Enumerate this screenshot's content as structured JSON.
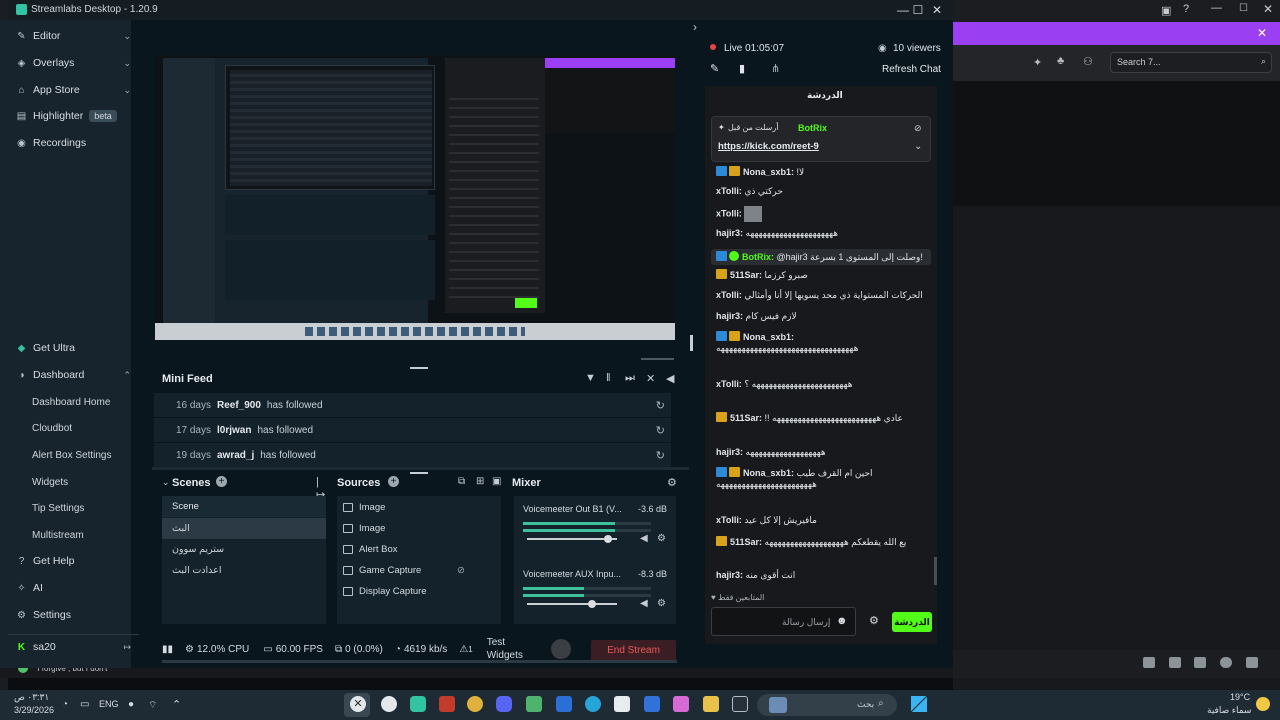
{
  "window": {
    "title": "Streamlabs Desktop - 1.20.9"
  },
  "bg_right": {
    "search_placeholder": "Search 7..."
  },
  "sidebar": {
    "items": [
      {
        "label": "Editor",
        "icon": "editor-icon"
      },
      {
        "label": "Overlays",
        "icon": "overlays-icon"
      },
      {
        "label": "App Store",
        "icon": "app-store-icon"
      },
      {
        "label": "Highlighter",
        "icon": "highlighter-icon",
        "badge": "beta"
      },
      {
        "label": "Recordings",
        "icon": "recordings-icon"
      }
    ],
    "bottom_items": [
      {
        "label": "Get Ultra",
        "icon": "ultra-icon"
      },
      {
        "label": "Dashboard",
        "icon": "dashboard-icon"
      }
    ],
    "dashboard_sub": [
      "Dashboard Home",
      "Cloudbot",
      "Alert Box Settings",
      "Widgets",
      "Tip Settings",
      "Multistream"
    ],
    "footer_items": [
      {
        "label": "Get Help",
        "icon": "help-icon"
      },
      {
        "label": "AI",
        "icon": "ai-icon"
      },
      {
        "label": "Settings",
        "icon": "settings-icon"
      }
    ],
    "user": "sa20"
  },
  "mini_feed": {
    "title": "Mini Feed",
    "rows": [
      {
        "days": "16 days",
        "user": "Reef_900",
        "action": "has followed"
      },
      {
        "days": "17 days",
        "user": "l0rjwan",
        "action": "has followed"
      },
      {
        "days": "19 days",
        "user": "awrad_j",
        "action": "has followed"
      }
    ]
  },
  "scenes": {
    "title": "Scenes",
    "header": "Scene",
    "items": [
      "البث",
      "ستريم سوون",
      "اعدادت البث"
    ]
  },
  "sources": {
    "title": "Sources",
    "items": [
      "Image",
      "Image",
      "Alert Box",
      "Game Capture",
      "Display Capture"
    ]
  },
  "mixer": {
    "title": "Mixer",
    "channels": [
      {
        "name": "Voicemeeter Out B1 (V...",
        "db": "-3.6 dB",
        "level": 0.72,
        "volume": 0.9
      },
      {
        "name": "Voicemeeter AUX Inpu...",
        "db": "-8.3 dB",
        "level": 0.48,
        "volume": 0.72
      }
    ]
  },
  "status": {
    "cpu": "12.0% CPU",
    "fps": "60.00 FPS",
    "dropped": "0 (0.0%)",
    "bitrate": "4619 kb/s",
    "alerts": "1",
    "test_widgets": "Test Widgets",
    "end_stream": "End Stream"
  },
  "chat": {
    "live": "Live 01:05:07",
    "viewers": "10 viewers",
    "refresh": "Refresh Chat",
    "title": "الدردشة",
    "pinned_by": "أرسلت من قبل",
    "pinned_user": "BotRix",
    "pinned_link": "https://kick.com/reet-9",
    "messages": [
      {
        "user": "Nona_sxb1",
        "text": "!لا",
        "badges": [
          "mod",
          "crown"
        ],
        "color": "#e2e6ea"
      },
      {
        "user": "xTolli",
        "text": "حركتي ذي",
        "badges": [],
        "color": "#e2e6ea"
      },
      {
        "user": "xTolli",
        "text": "",
        "badges": [],
        "color": "#e2e6ea"
      },
      {
        "user": "hajir3",
        "text": "هههههههههههههههههههههه",
        "badges": [],
        "color": "#e2e6ea"
      },
      {
        "user": "BotRix",
        "text": "@hajir3 وصلت إلى المستوى 1 بسرعة!",
        "badges": [
          "mod",
          "ver"
        ],
        "color": "#53fc18"
      },
      {
        "user": "511Sar",
        "text": "صبرو كرزما",
        "badges": [
          "crown"
        ],
        "color": "#e2e6ea"
      },
      {
        "user": "xTolli",
        "text": "الحركات المستواية ذي محد يسويها إلا أنا وأمثالي",
        "badges": [],
        "color": "#e2e6ea"
      },
      {
        "user": "hajir3",
        "text": "لازم فيس كام",
        "badges": [],
        "color": "#e2e6ea"
      },
      {
        "user": "Nona_sxb1",
        "text": "هههههههههههههههههههههههههههههههههه",
        "badges": [
          "mod",
          "crown"
        ],
        "color": "#e2e6ea"
      },
      {
        "user": "xTolli",
        "text": "هههههههههههههههههههههههه ؟",
        "badges": [],
        "color": "#e2e6ea"
      },
      {
        "user": "511Sar",
        "text": "!! عادي هههههههههههههههههههههههههه",
        "badges": [
          "crown"
        ],
        "color": "#e2e6ea"
      },
      {
        "user": "hajir3",
        "text": "ههههههههههههههههههه",
        "badges": [],
        "color": "#e2e6ea"
      },
      {
        "user": "Nona_sxb1",
        "text": "احين ام القرف طيب هههههههههههههههههههههههه",
        "badges": [
          "mod",
          "crown"
        ],
        "color": "#e2e6ea"
      },
      {
        "user": "xTolli",
        "text": "مافيريش إلا كل عيد",
        "badges": [],
        "color": "#e2e6ea"
      },
      {
        "user": "511Sar",
        "text": "يع الله يقطعكم هههههههههههههههههههه",
        "badges": [
          "crown"
        ],
        "color": "#e2e6ea"
      },
      {
        "user": "hajir3",
        "text": "انت أقوى منه",
        "badges": [],
        "color": "#e2e6ea"
      }
    ],
    "followers_only": "المتابعين فقط",
    "input_placeholder": "إرسال رسالة",
    "send_label": "الدردشة"
  },
  "taskbar": {
    "time": "٠٣:٣١ ص",
    "date": "3/29/2026",
    "lang": "ENG",
    "weather_temp": "19°C",
    "weather_desc": "سماء صافية",
    "search_placeholder": "بحث",
    "notify_text": "* I forgive , but I don't"
  }
}
